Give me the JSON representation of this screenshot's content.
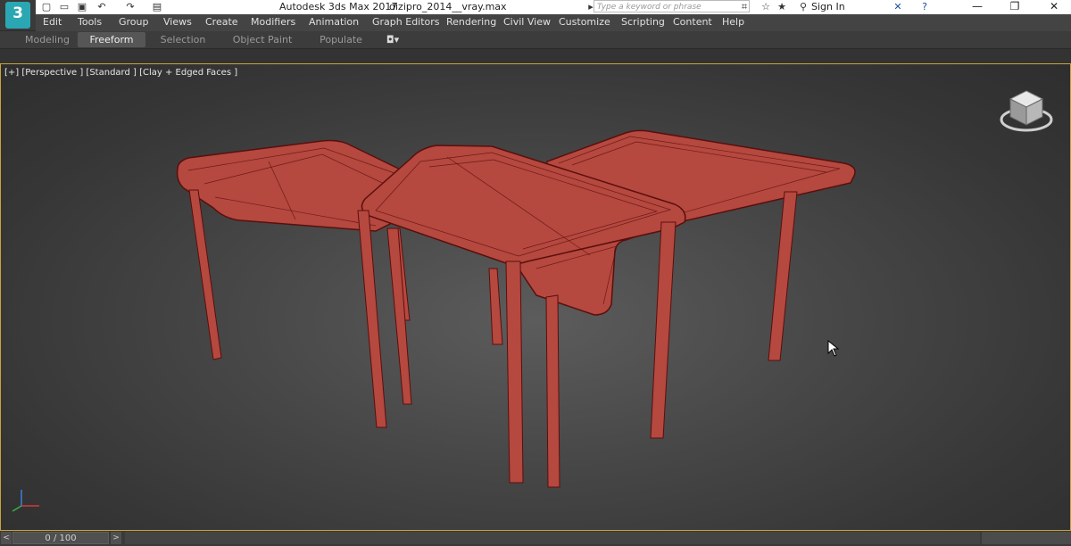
{
  "titlebar": {
    "app_title": "Autodesk 3ds Max 2017",
    "file_name": "dizipro_2014__vray.max",
    "search_placeholder": "Type a keyword or phrase",
    "sign_in": "Sign In",
    "app_logo": "3"
  },
  "menu": [
    "Edit",
    "Tools",
    "Group",
    "Views",
    "Create",
    "Modifiers",
    "Animation",
    "Graph Editors",
    "Rendering",
    "Civil View",
    "Customize",
    "Scripting",
    "Content",
    "Help"
  ],
  "ribbon_tabs": [
    "Modeling",
    "Freeform",
    "Selection",
    "Object Paint",
    "Populate"
  ],
  "ribbon_active": "Freeform",
  "viewport": {
    "label": "[+] [Perspective ] [Standard ] [Clay + Edged Faces ]",
    "object_color": "#b5483f",
    "edge_color": "#5a0f0c",
    "border_color": "#c9a33a"
  },
  "timeline": {
    "frame_readout": "0 / 100",
    "prev_label": "<",
    "next_label": ">"
  },
  "icons": [
    "new-file-icon",
    "open-icon",
    "save-icon",
    "undo-icon",
    "redo-icon",
    "project-icon",
    "binoculars-icon",
    "star-icon",
    "user-icon",
    "x-exchange-icon",
    "help-icon",
    "minimize-icon",
    "restore-icon",
    "close-icon",
    "viewcube-icon",
    "axis-tripod-icon",
    "mouse-cursor-icon"
  ]
}
